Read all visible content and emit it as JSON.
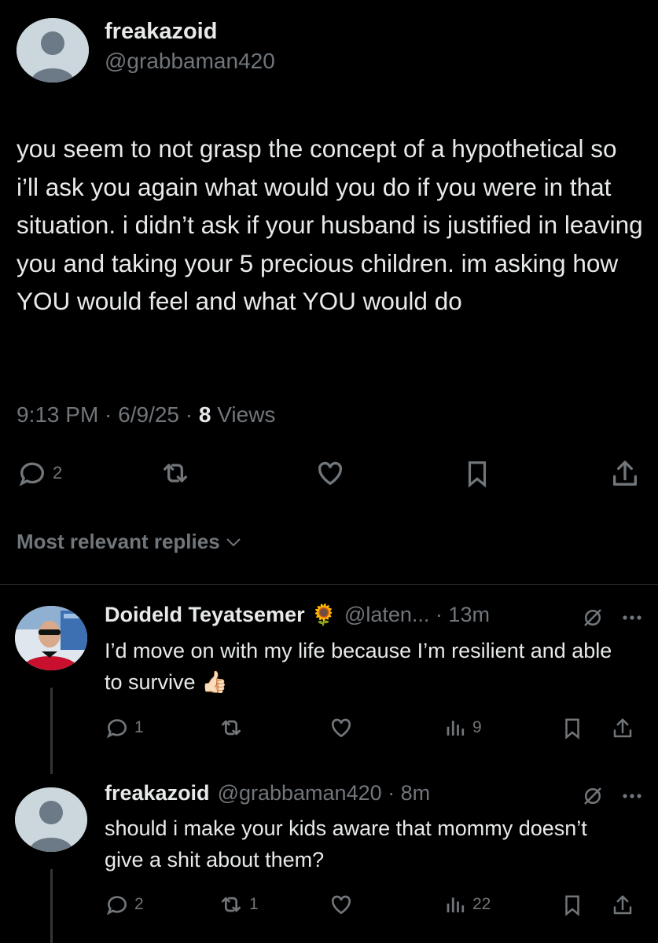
{
  "tweet": {
    "name": "freakazoid",
    "handle": "@grabbaman420",
    "text": "you seem to not grasp the concept of a hypothetical so i’ll ask you again what would you do if you were in that situation. i didn’t ask if your husband is justified in leaving you and taking your 5 precious children. im asking how YOU would feel and what YOU would do",
    "time": "9:13 PM · 6/9/25 · ",
    "views_count": "8",
    "views_label": " Views",
    "reply_count": "2"
  },
  "sort": {
    "label": "Most relevant replies"
  },
  "replies": [
    {
      "name": "Doideld Teyatsemer",
      "emoji": "🌻",
      "handle": "@laten... · 13m",
      "text": "I’d move on with my life because I’m resilient and able to survive 👍🏻",
      "reply_count": "1",
      "repost_count": "",
      "views": "9"
    },
    {
      "name": "freakazoid",
      "handle": "@grabbaman420 · 8m",
      "text": "should i make your kids aware that mommy doesn’t give a shit about them?",
      "reply_count": "2",
      "repost_count": "1",
      "views": "22"
    }
  ],
  "colors": {
    "background": "#000000",
    "text": "#e7e9ea",
    "muted": "#71767b",
    "divider": "#2f3336"
  }
}
